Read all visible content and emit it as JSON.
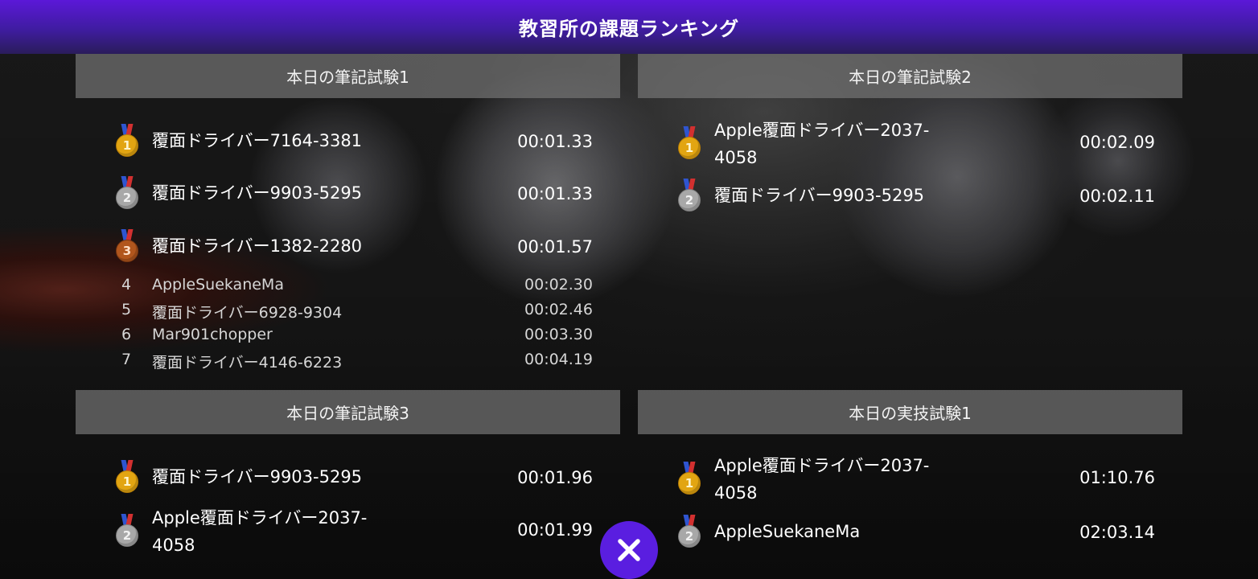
{
  "header": {
    "title": "教習所の課題ランキング"
  },
  "panels": [
    {
      "title": "本日の筆記試験1",
      "top": [
        {
          "medal": "gold-medal-icon",
          "rank": "1",
          "name": "覆面ドライバー7164-3381",
          "time": "00:01.33"
        },
        {
          "medal": "silver-medal-icon",
          "rank": "2",
          "name": "覆面ドライバー9903-5295",
          "time": "00:01.33"
        },
        {
          "medal": "bronze-medal-icon",
          "rank": "3",
          "name": "覆面ドライバー1382-2280",
          "time": "00:01.57"
        }
      ],
      "rest": [
        {
          "rank": "4",
          "name": "AppleSuekaneMa",
          "time": "00:02.30"
        },
        {
          "rank": "5",
          "name": "覆面ドライバー6928-9304",
          "time": "00:02.46"
        },
        {
          "rank": "6",
          "name": "Mar901chopper",
          "time": "00:03.30"
        },
        {
          "rank": "7",
          "name": "覆面ドライバー4146-6223",
          "time": "00:04.19"
        }
      ]
    },
    {
      "title": "本日の筆記試験2",
      "top": [
        {
          "medal": "gold-medal-icon",
          "rank": "1",
          "name": "Apple覆面ドライバー2037-4058",
          "time": "00:02.09"
        },
        {
          "medal": "silver-medal-icon",
          "rank": "2",
          "name": "覆面ドライバー9903-5295",
          "time": "00:02.11"
        }
      ]
    },
    {
      "title": "本日の筆記試験3",
      "top": [
        {
          "medal": "gold-medal-icon",
          "rank": "1",
          "name": "覆面ドライバー9903-5295",
          "time": "00:01.96"
        },
        {
          "medal": "silver-medal-icon",
          "rank": "2",
          "name": "Apple覆面ドライバー2037-4058",
          "time": "00:01.99"
        }
      ]
    },
    {
      "title": "本日の実技試験1",
      "top": [
        {
          "medal": "gold-medal-icon",
          "rank": "1",
          "name": "Apple覆面ドライバー2037-4058",
          "time": "01:10.76"
        },
        {
          "medal": "silver-medal-icon",
          "rank": "2",
          "name": "AppleSuekaneMa",
          "time": "02:03.14"
        }
      ]
    }
  ],
  "close_button": {
    "icon": "close-icon",
    "color": "#5a1ee0"
  },
  "colors": {
    "header_start": "#5b18d8",
    "header_end": "#2a1c5a",
    "gold": "#e2a512",
    "silver": "#a8a8a8",
    "bronze": "#b1561d"
  }
}
